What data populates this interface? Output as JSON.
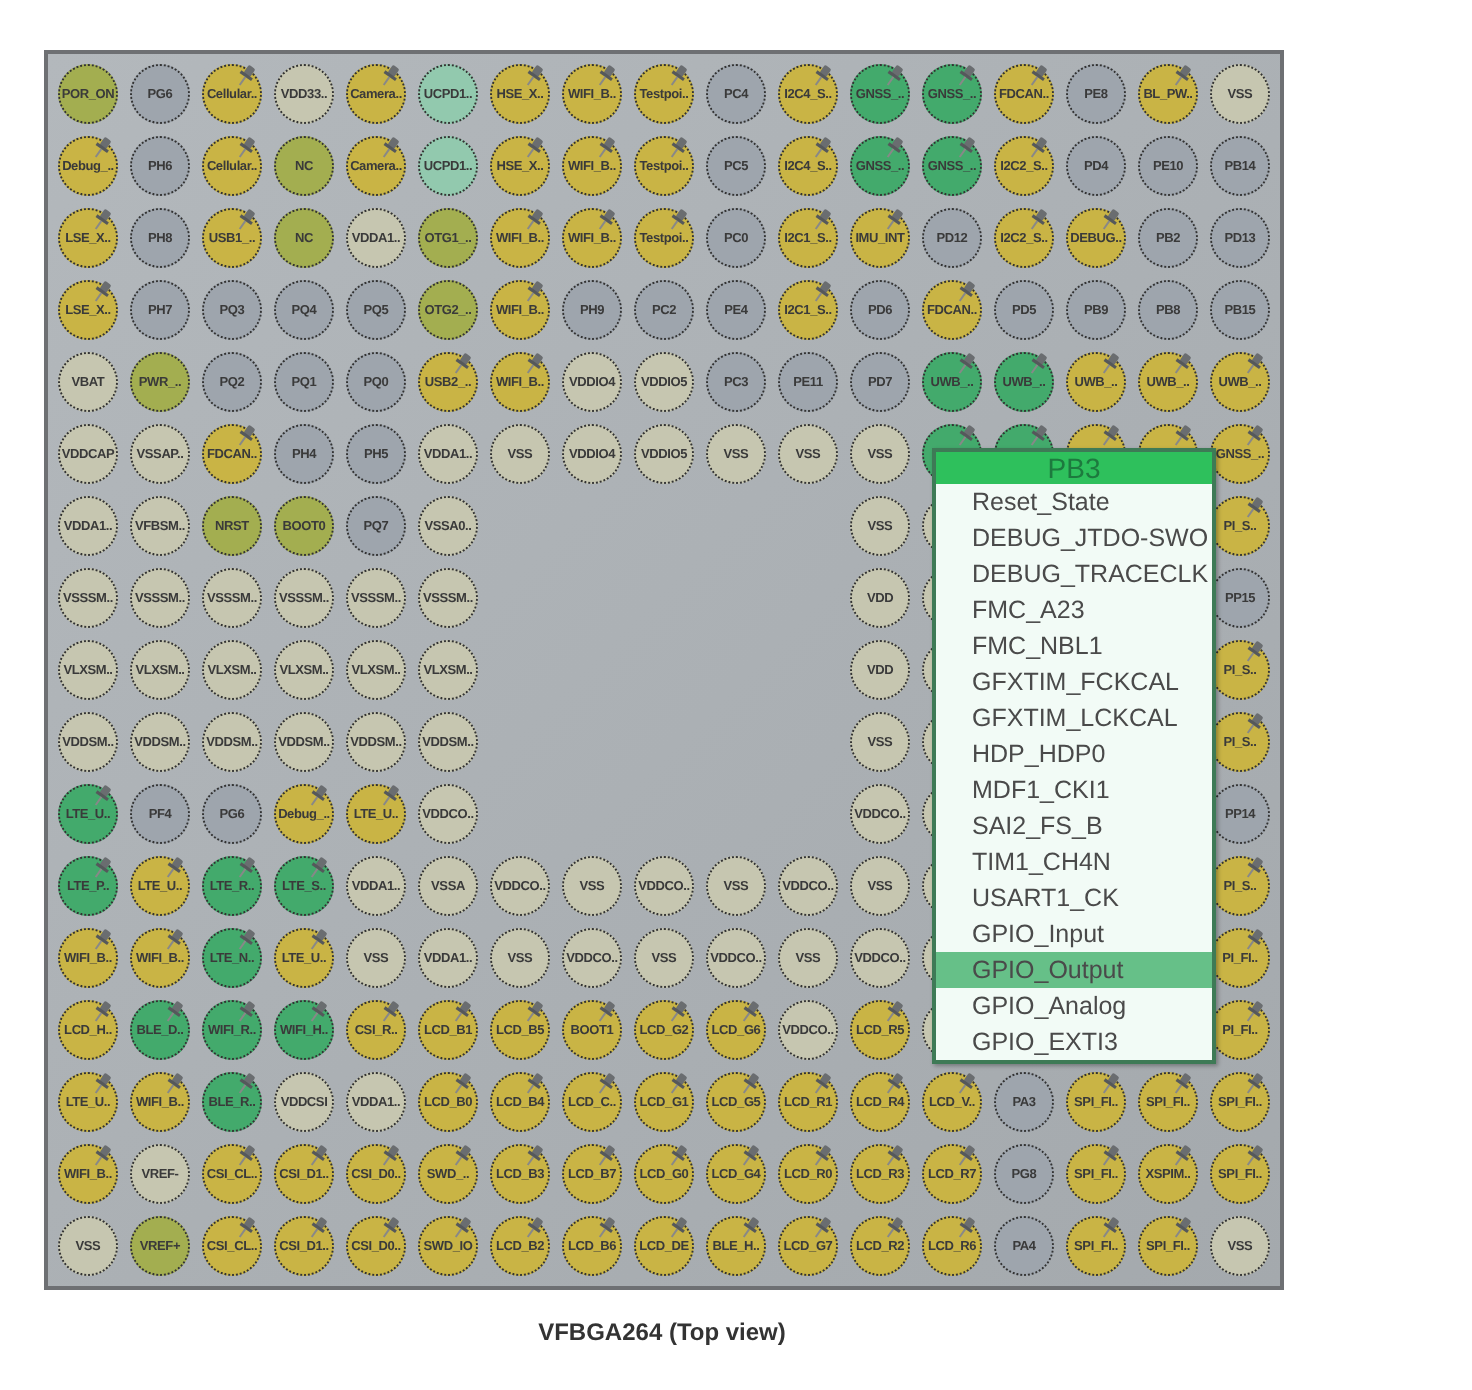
{
  "package": {
    "rows": [
      {
        "cells": [
          {
            "kind": "ball",
            "label": "POR_ON",
            "color": "#a3ae50",
            "pinned": false
          },
          {
            "kind": "ball",
            "label": "PG6",
            "color": "#9ea5ad",
            "pinned": false
          },
          {
            "kind": "ball",
            "label": "Cellular..",
            "color": "#c9b445",
            "pinned": true
          },
          {
            "kind": "ball",
            "label": "VDD33..",
            "color": "#c6c6b0",
            "pinned": false
          },
          {
            "kind": "ball",
            "label": "Camera..",
            "color": "#c9b445",
            "pinned": true
          },
          {
            "kind": "ball",
            "label": "UCPD1..",
            "color": "#92c9ae",
            "pinned": false
          },
          {
            "kind": "ball",
            "label": "HSE_X..",
            "color": "#c9b445",
            "pinned": true
          },
          {
            "kind": "ball",
            "label": "WIFI_B..",
            "color": "#c9b445",
            "pinned": true
          },
          {
            "kind": "ball",
            "label": "Testpoi..",
            "color": "#c9b445",
            "pinned": true
          },
          {
            "kind": "ball",
            "label": "PC4",
            "color": "#9ea5ad",
            "pinned": false
          },
          {
            "kind": "ball",
            "label": "I2C4_S..",
            "color": "#c9b445",
            "pinned": true
          },
          {
            "kind": "ball",
            "label": "GNSS_..",
            "color": "#43aa6c",
            "pinned": true
          },
          {
            "kind": "ball",
            "label": "GNSS_..",
            "color": "#43aa6c",
            "pinned": true
          },
          {
            "kind": "ball",
            "label": "FDCAN..",
            "color": "#c9b445",
            "pinned": true
          },
          {
            "kind": "ball",
            "label": "PE8",
            "color": "#9ea5ad",
            "pinned": false
          },
          {
            "kind": "ball",
            "label": "BL_PW..",
            "color": "#c9b445",
            "pinned": true
          },
          {
            "kind": "ball",
            "label": "VSS",
            "color": "#c6c6b0",
            "pinned": false
          }
        ]
      },
      {
        "cells": [
          {
            "kind": "ball",
            "label": "Debug_..",
            "color": "#c9b445",
            "pinned": true
          },
          {
            "kind": "ball",
            "label": "PH6",
            "color": "#9ea5ad",
            "pinned": false
          },
          {
            "kind": "ball",
            "label": "Cellular..",
            "color": "#c9b445",
            "pinned": true
          },
          {
            "kind": "ball",
            "label": "NC",
            "color": "#a3ae50",
            "pinned": false
          },
          {
            "kind": "ball",
            "label": "Camera..",
            "color": "#c9b445",
            "pinned": true
          },
          {
            "kind": "ball",
            "label": "UCPD1..",
            "color": "#92c9ae",
            "pinned": false
          },
          {
            "kind": "ball",
            "label": "HSE_X..",
            "color": "#c9b445",
            "pinned": true
          },
          {
            "kind": "ball",
            "label": "WIFI_B..",
            "color": "#c9b445",
            "pinned": true
          },
          {
            "kind": "ball",
            "label": "Testpoi..",
            "color": "#c9b445",
            "pinned": true
          },
          {
            "kind": "ball",
            "label": "PC5",
            "color": "#9ea5ad",
            "pinned": false
          },
          {
            "kind": "ball",
            "label": "I2C4_S..",
            "color": "#c9b445",
            "pinned": true
          },
          {
            "kind": "ball",
            "label": "GNSS_..",
            "color": "#43aa6c",
            "pinned": true
          },
          {
            "kind": "ball",
            "label": "GNSS_..",
            "color": "#43aa6c",
            "pinned": true
          },
          {
            "kind": "ball",
            "label": "I2C2_S..",
            "color": "#c9b445",
            "pinned": true
          },
          {
            "kind": "ball",
            "label": "PD4",
            "color": "#9ea5ad",
            "pinned": false
          },
          {
            "kind": "ball",
            "label": "PE10",
            "color": "#9ea5ad",
            "pinned": false
          },
          {
            "kind": "ball",
            "label": "PB14",
            "color": "#9ea5ad",
            "pinned": false
          }
        ]
      },
      {
        "cells": [
          {
            "kind": "ball",
            "label": "LSE_X..",
            "color": "#c9b445",
            "pinned": true
          },
          {
            "kind": "ball",
            "label": "PH8",
            "color": "#9ea5ad",
            "pinned": false
          },
          {
            "kind": "ball",
            "label": "USB1_..",
            "color": "#c9b445",
            "pinned": true
          },
          {
            "kind": "ball",
            "label": "NC",
            "color": "#a3ae50",
            "pinned": false
          },
          {
            "kind": "ball",
            "label": "VDDA1..",
            "color": "#c6c6b0",
            "pinned": false
          },
          {
            "kind": "ball",
            "label": "OTG1_..",
            "color": "#a3ae50",
            "pinned": false
          },
          {
            "kind": "ball",
            "label": "WIFI_B..",
            "color": "#c9b445",
            "pinned": true
          },
          {
            "kind": "ball",
            "label": "WIFI_B..",
            "color": "#c9b445",
            "pinned": true
          },
          {
            "kind": "ball",
            "label": "Testpoi..",
            "color": "#c9b445",
            "pinned": true
          },
          {
            "kind": "ball",
            "label": "PC0",
            "color": "#9ea5ad",
            "pinned": false
          },
          {
            "kind": "ball",
            "label": "I2C1_S..",
            "color": "#c9b445",
            "pinned": true
          },
          {
            "kind": "ball",
            "label": "IMU_INT",
            "color": "#c9b445",
            "pinned": true
          },
          {
            "kind": "ball",
            "label": "PD12",
            "color": "#9ea5ad",
            "pinned": false
          },
          {
            "kind": "ball",
            "label": "I2C2_S..",
            "color": "#c9b445",
            "pinned": true
          },
          {
            "kind": "ball",
            "label": "DEBUG..",
            "color": "#c9b445",
            "pinned": true
          },
          {
            "kind": "ball",
            "label": "PB2",
            "color": "#9ea5ad",
            "pinned": false
          },
          {
            "kind": "ball",
            "label": "PD13",
            "color": "#9ea5ad",
            "pinned": false
          }
        ]
      },
      {
        "cells": [
          {
            "kind": "ball",
            "label": "LSE_X..",
            "color": "#c9b445",
            "pinned": true
          },
          {
            "kind": "ball",
            "label": "PH7",
            "color": "#9ea5ad",
            "pinned": false
          },
          {
            "kind": "ball",
            "label": "PQ3",
            "color": "#9ea5ad",
            "pinned": false
          },
          {
            "kind": "ball",
            "label": "PQ4",
            "color": "#9ea5ad",
            "pinned": false
          },
          {
            "kind": "ball",
            "label": "PQ5",
            "color": "#9ea5ad",
            "pinned": false
          },
          {
            "kind": "ball",
            "label": "OTG2_..",
            "color": "#a3ae50",
            "pinned": false
          },
          {
            "kind": "ball",
            "label": "WIFI_B..",
            "color": "#c9b445",
            "pinned": true
          },
          {
            "kind": "ball",
            "label": "PH9",
            "color": "#9ea5ad",
            "pinned": false
          },
          {
            "kind": "ball",
            "label": "PC2",
            "color": "#9ea5ad",
            "pinned": false
          },
          {
            "kind": "ball",
            "label": "PE4",
            "color": "#9ea5ad",
            "pinned": false
          },
          {
            "kind": "ball",
            "label": "I2C1_S..",
            "color": "#c9b445",
            "pinned": true
          },
          {
            "kind": "ball",
            "label": "PD6",
            "color": "#9ea5ad",
            "pinned": false
          },
          {
            "kind": "ball",
            "label": "FDCAN..",
            "color": "#c9b445",
            "pinned": true
          },
          {
            "kind": "ball",
            "label": "PD5",
            "color": "#9ea5ad",
            "pinned": false
          },
          {
            "kind": "ball",
            "label": "PB9",
            "color": "#9ea5ad",
            "pinned": false
          },
          {
            "kind": "ball",
            "label": "PB8",
            "color": "#9ea5ad",
            "pinned": false
          },
          {
            "kind": "ball",
            "label": "PB15",
            "color": "#9ea5ad",
            "pinned": false
          }
        ]
      },
      {
        "cells": [
          {
            "kind": "ball",
            "label": "VBAT",
            "color": "#c6c6b0",
            "pinned": false
          },
          {
            "kind": "ball",
            "label": "PWR_..",
            "color": "#a3ae50",
            "pinned": false
          },
          {
            "kind": "ball",
            "label": "PQ2",
            "color": "#9ea5ad",
            "pinned": false
          },
          {
            "kind": "ball",
            "label": "PQ1",
            "color": "#9ea5ad",
            "pinned": false
          },
          {
            "kind": "ball",
            "label": "PQ0",
            "color": "#9ea5ad",
            "pinned": false
          },
          {
            "kind": "ball",
            "label": "USB2_..",
            "color": "#c9b445",
            "pinned": true
          },
          {
            "kind": "ball",
            "label": "WIFI_B..",
            "color": "#c9b445",
            "pinned": true
          },
          {
            "kind": "ball",
            "label": "VDDIO4",
            "color": "#c6c6b0",
            "pinned": false
          },
          {
            "kind": "ball",
            "label": "VDDIO5",
            "color": "#c6c6b0",
            "pinned": false
          },
          {
            "kind": "ball",
            "label": "PC3",
            "color": "#9ea5ad",
            "pinned": false
          },
          {
            "kind": "ball",
            "label": "PE11",
            "color": "#9ea5ad",
            "pinned": false
          },
          {
            "kind": "ball",
            "label": "PD7",
            "color": "#9ea5ad",
            "pinned": false
          },
          {
            "kind": "ball",
            "label": "UWB_..",
            "color": "#43aa6c",
            "pinned": true
          },
          {
            "kind": "ball",
            "label": "UWB_..",
            "color": "#43aa6c",
            "pinned": true
          },
          {
            "kind": "ball",
            "label": "UWB_..",
            "color": "#c9b445",
            "pinned": true
          },
          {
            "kind": "ball",
            "label": "UWB_..",
            "color": "#c9b445",
            "pinned": true
          },
          {
            "kind": "ball",
            "label": "UWB_..",
            "color": "#c9b445",
            "pinned": true
          }
        ]
      },
      {
        "cells": [
          {
            "kind": "ball",
            "label": "VDDCAP",
            "color": "#c6c6b0",
            "pinned": false
          },
          {
            "kind": "ball",
            "label": "VSSAP..",
            "color": "#c6c6b0",
            "pinned": false
          },
          {
            "kind": "ball",
            "label": "FDCAN..",
            "color": "#c9b445",
            "pinned": true
          },
          {
            "kind": "ball",
            "label": "PH4",
            "color": "#9ea5ad",
            "pinned": false
          },
          {
            "kind": "ball",
            "label": "PH5",
            "color": "#9ea5ad",
            "pinned": false
          },
          {
            "kind": "ball",
            "label": "VDDA1..",
            "color": "#c6c6b0",
            "pinned": false
          },
          {
            "kind": "ball",
            "label": "VSS",
            "color": "#c6c6b0",
            "pinned": false
          },
          {
            "kind": "ball",
            "label": "VDDIO4",
            "color": "#c6c6b0",
            "pinned": false
          },
          {
            "kind": "ball",
            "label": "VDDIO5",
            "color": "#c6c6b0",
            "pinned": false
          },
          {
            "kind": "ball",
            "label": "VSS",
            "color": "#c6c6b0",
            "pinned": false
          },
          {
            "kind": "ball",
            "label": "VSS",
            "color": "#c6c6b0",
            "pinned": false
          },
          {
            "kind": "ball",
            "label": "VSS",
            "color": "#c6c6b0",
            "pinned": false
          },
          {
            "kind": "ball",
            "color": "#43aa6c",
            "pinned": true
          },
          {
            "kind": "ball",
            "color": "#43aa6c",
            "pinned": true
          },
          {
            "kind": "ball",
            "color": "#c9b445",
            "pinned": true
          },
          {
            "kind": "ball",
            "color": "#c9b445",
            "pinned": true
          },
          {
            "kind": "ball",
            "label": "GNSS_..",
            "color": "#c9b445",
            "pinned": true
          }
        ]
      },
      {
        "cells": [
          {
            "kind": "ball",
            "label": "VDDA1..",
            "color": "#c6c6b0",
            "pinned": false
          },
          {
            "kind": "ball",
            "label": "VFBSM..",
            "color": "#c6c6b0",
            "pinned": false
          },
          {
            "kind": "ball",
            "label": "NRST",
            "color": "#a3ae50",
            "pinned": false
          },
          {
            "kind": "ball",
            "label": "BOOT0",
            "color": "#a3ae50",
            "pinned": false
          },
          {
            "kind": "ball",
            "label": "PQ7",
            "color": "#9ea5ad",
            "pinned": false
          },
          {
            "kind": "ball",
            "label": "VSSA0..",
            "color": "#c6c6b0",
            "pinned": false
          },
          {
            "kind": "gap"
          },
          {
            "kind": "gap"
          },
          {
            "kind": "gap"
          },
          {
            "kind": "gap"
          },
          {
            "kind": "gap"
          },
          {
            "kind": "ball",
            "label": "VSS",
            "color": "#c6c6b0",
            "pinned": false
          },
          {
            "kind": "ball",
            "color": "#c6c6b0"
          },
          {
            "kind": "gap"
          },
          {
            "kind": "gap"
          },
          {
            "kind": "gap"
          },
          {
            "kind": "ball",
            "label": "PI_S..",
            "color": "#c9b445",
            "pinned": true
          }
        ]
      },
      {
        "cells": [
          {
            "kind": "ball",
            "label": "VSSSM..",
            "color": "#c6c6b0",
            "pinned": false
          },
          {
            "kind": "ball",
            "label": "VSSSM..",
            "color": "#c6c6b0",
            "pinned": false
          },
          {
            "kind": "ball",
            "label": "VSSSM..",
            "color": "#c6c6b0",
            "pinned": false
          },
          {
            "kind": "ball",
            "label": "VSSSM..",
            "color": "#c6c6b0",
            "pinned": false
          },
          {
            "kind": "ball",
            "label": "VSSSM..",
            "color": "#c6c6b0",
            "pinned": false
          },
          {
            "kind": "ball",
            "label": "VSSSM..",
            "color": "#c6c6b0",
            "pinned": false
          },
          {
            "kind": "gap"
          },
          {
            "kind": "gap"
          },
          {
            "kind": "gap"
          },
          {
            "kind": "gap"
          },
          {
            "kind": "gap"
          },
          {
            "kind": "ball",
            "label": "VDD",
            "color": "#c6c6b0",
            "pinned": false
          },
          {
            "kind": "ball",
            "color": "#c6c6b0"
          },
          {
            "kind": "gap"
          },
          {
            "kind": "gap"
          },
          {
            "kind": "gap"
          },
          {
            "kind": "ball",
            "label": "PP15",
            "color": "#9ea5ad",
            "pinned": false
          }
        ]
      },
      {
        "cells": [
          {
            "kind": "ball",
            "label": "VLXSM..",
            "color": "#c6c6b0",
            "pinned": false
          },
          {
            "kind": "ball",
            "label": "VLXSM..",
            "color": "#c6c6b0",
            "pinned": false
          },
          {
            "kind": "ball",
            "label": "VLXSM..",
            "color": "#c6c6b0",
            "pinned": false
          },
          {
            "kind": "ball",
            "label": "VLXSM..",
            "color": "#c6c6b0",
            "pinned": false
          },
          {
            "kind": "ball",
            "label": "VLXSM..",
            "color": "#c6c6b0",
            "pinned": false
          },
          {
            "kind": "ball",
            "label": "VLXSM..",
            "color": "#c6c6b0",
            "pinned": false
          },
          {
            "kind": "gap"
          },
          {
            "kind": "gap"
          },
          {
            "kind": "gap"
          },
          {
            "kind": "gap"
          },
          {
            "kind": "gap"
          },
          {
            "kind": "ball",
            "label": "VDD",
            "color": "#c6c6b0",
            "pinned": false
          },
          {
            "kind": "ball",
            "color": "#c6c6b0"
          },
          {
            "kind": "gap"
          },
          {
            "kind": "gap"
          },
          {
            "kind": "gap"
          },
          {
            "kind": "ball",
            "label": "PI_S..",
            "color": "#c9b445",
            "pinned": true
          }
        ]
      },
      {
        "cells": [
          {
            "kind": "ball",
            "label": "VDDSM..",
            "color": "#c6c6b0",
            "pinned": false
          },
          {
            "kind": "ball",
            "label": "VDDSM..",
            "color": "#c6c6b0",
            "pinned": false
          },
          {
            "kind": "ball",
            "label": "VDDSM..",
            "color": "#c6c6b0",
            "pinned": false
          },
          {
            "kind": "ball",
            "label": "VDDSM..",
            "color": "#c6c6b0",
            "pinned": false
          },
          {
            "kind": "ball",
            "label": "VDDSM..",
            "color": "#c6c6b0",
            "pinned": false
          },
          {
            "kind": "ball",
            "label": "VDDSM..",
            "color": "#c6c6b0",
            "pinned": false
          },
          {
            "kind": "gap"
          },
          {
            "kind": "gap"
          },
          {
            "kind": "gap"
          },
          {
            "kind": "gap"
          },
          {
            "kind": "gap"
          },
          {
            "kind": "ball",
            "label": "VSS",
            "color": "#c6c6b0",
            "pinned": false
          },
          {
            "kind": "ball",
            "color": "#c6c6b0"
          },
          {
            "kind": "gap"
          },
          {
            "kind": "gap"
          },
          {
            "kind": "gap"
          },
          {
            "kind": "ball",
            "label": "PI_S..",
            "color": "#c9b445",
            "pinned": true
          }
        ]
      },
      {
        "cells": [
          {
            "kind": "ball",
            "label": "LTE_U..",
            "color": "#43aa6c",
            "pinned": true
          },
          {
            "kind": "ball",
            "label": "PF4",
            "color": "#9ea5ad",
            "pinned": false
          },
          {
            "kind": "ball",
            "label": "PG6",
            "color": "#9ea5ad",
            "pinned": false
          },
          {
            "kind": "ball",
            "label": "Debug_..",
            "color": "#c9b445",
            "pinned": true
          },
          {
            "kind": "ball",
            "label": "LTE_U..",
            "color": "#c9b445",
            "pinned": true
          },
          {
            "kind": "ball",
            "label": "VDDCO..",
            "color": "#c6c6b0",
            "pinned": false
          },
          {
            "kind": "gap"
          },
          {
            "kind": "gap"
          },
          {
            "kind": "gap"
          },
          {
            "kind": "gap"
          },
          {
            "kind": "gap"
          },
          {
            "kind": "ball",
            "label": "VDDCO..",
            "color": "#c6c6b0",
            "pinned": false
          },
          {
            "kind": "ball",
            "color": "#c6c6b0"
          },
          {
            "kind": "gap"
          },
          {
            "kind": "gap"
          },
          {
            "kind": "gap"
          },
          {
            "kind": "ball",
            "label": "PP14",
            "color": "#9ea5ad",
            "pinned": false
          }
        ]
      },
      {
        "cells": [
          {
            "kind": "ball",
            "label": "LTE_P..",
            "color": "#43aa6c",
            "pinned": true
          },
          {
            "kind": "ball",
            "label": "LTE_U..",
            "color": "#c9b445",
            "pinned": true
          },
          {
            "kind": "ball",
            "label": "LTE_R..",
            "color": "#43aa6c",
            "pinned": true
          },
          {
            "kind": "ball",
            "label": "LTE_S..",
            "color": "#43aa6c",
            "pinned": true
          },
          {
            "kind": "ball",
            "label": "VDDA1..",
            "color": "#c6c6b0",
            "pinned": false
          },
          {
            "kind": "ball",
            "label": "VSSA",
            "color": "#c6c6b0",
            "pinned": false
          },
          {
            "kind": "ball",
            "label": "VDDCO..",
            "color": "#c6c6b0",
            "pinned": false
          },
          {
            "kind": "ball",
            "label": "VSS",
            "color": "#c6c6b0",
            "pinned": false
          },
          {
            "kind": "ball",
            "label": "VDDCO..",
            "color": "#c6c6b0",
            "pinned": false
          },
          {
            "kind": "ball",
            "label": "VSS",
            "color": "#c6c6b0",
            "pinned": false
          },
          {
            "kind": "ball",
            "label": "VDDCO..",
            "color": "#c6c6b0",
            "pinned": false
          },
          {
            "kind": "ball",
            "label": "VSS",
            "color": "#c6c6b0",
            "pinned": false
          },
          {
            "kind": "ball",
            "color": "#c6c6b0"
          },
          {
            "kind": "gap"
          },
          {
            "kind": "gap"
          },
          {
            "kind": "gap"
          },
          {
            "kind": "ball",
            "label": "PI_S..",
            "color": "#c9b445",
            "pinned": true
          }
        ]
      },
      {
        "cells": [
          {
            "kind": "ball",
            "label": "WIFI_B..",
            "color": "#c9b445",
            "pinned": true
          },
          {
            "kind": "ball",
            "label": "WIFI_B..",
            "color": "#c9b445",
            "pinned": true
          },
          {
            "kind": "ball",
            "label": "LTE_N..",
            "color": "#43aa6c",
            "pinned": true
          },
          {
            "kind": "ball",
            "label": "LTE_U..",
            "color": "#c9b445",
            "pinned": true
          },
          {
            "kind": "ball",
            "label": "VSS",
            "color": "#c6c6b0",
            "pinned": false
          },
          {
            "kind": "ball",
            "label": "VDDA1..",
            "color": "#c6c6b0",
            "pinned": false
          },
          {
            "kind": "ball",
            "label": "VSS",
            "color": "#c6c6b0",
            "pinned": false
          },
          {
            "kind": "ball",
            "label": "VDDCO..",
            "color": "#c6c6b0",
            "pinned": false
          },
          {
            "kind": "ball",
            "label": "VSS",
            "color": "#c6c6b0",
            "pinned": false
          },
          {
            "kind": "ball",
            "label": "VDDCO..",
            "color": "#c6c6b0",
            "pinned": false
          },
          {
            "kind": "ball",
            "label": "VSS",
            "color": "#c6c6b0",
            "pinned": false
          },
          {
            "kind": "ball",
            "label": "VDDCO..",
            "color": "#c6c6b0",
            "pinned": false
          },
          {
            "kind": "ball",
            "color": "#c6c6b0"
          },
          {
            "kind": "gap"
          },
          {
            "kind": "gap"
          },
          {
            "kind": "gap"
          },
          {
            "kind": "ball",
            "label": "PI_FI..",
            "color": "#c9b445",
            "pinned": true
          }
        ]
      },
      {
        "cells": [
          {
            "kind": "ball",
            "label": "LCD_H..",
            "color": "#c9b445",
            "pinned": true
          },
          {
            "kind": "ball",
            "label": "BLE_D..",
            "color": "#43aa6c",
            "pinned": true
          },
          {
            "kind": "ball",
            "label": "WIFI_R..",
            "color": "#43aa6c",
            "pinned": true
          },
          {
            "kind": "ball",
            "label": "WIFI_H..",
            "color": "#43aa6c",
            "pinned": true
          },
          {
            "kind": "ball",
            "label": "CSI_R..",
            "color": "#c9b445",
            "pinned": true
          },
          {
            "kind": "ball",
            "label": "LCD_B1",
            "color": "#c9b445",
            "pinned": true
          },
          {
            "kind": "ball",
            "label": "LCD_B5",
            "color": "#c9b445",
            "pinned": true
          },
          {
            "kind": "ball",
            "label": "BOOT1",
            "color": "#c9b445",
            "pinned": true
          },
          {
            "kind": "ball",
            "label": "LCD_G2",
            "color": "#c9b445",
            "pinned": true
          },
          {
            "kind": "ball",
            "label": "LCD_G6",
            "color": "#c9b445",
            "pinned": true
          },
          {
            "kind": "ball",
            "label": "VDDCO..",
            "color": "#c6c6b0",
            "pinned": false
          },
          {
            "kind": "ball",
            "label": "LCD_R5",
            "color": "#c9b445",
            "pinned": true
          },
          {
            "kind": "ball",
            "color": "#c6c6b0"
          },
          {
            "kind": "gap"
          },
          {
            "kind": "gap"
          },
          {
            "kind": "gap"
          },
          {
            "kind": "ball",
            "label": "PI_FI..",
            "color": "#c9b445",
            "pinned": true
          }
        ]
      },
      {
        "cells": [
          {
            "kind": "ball",
            "label": "LTE_U..",
            "color": "#c9b445",
            "pinned": true
          },
          {
            "kind": "ball",
            "label": "WIFI_B..",
            "color": "#c9b445",
            "pinned": true
          },
          {
            "kind": "ball",
            "label": "BLE_R..",
            "color": "#43aa6c",
            "pinned": true
          },
          {
            "kind": "ball",
            "label": "VDDCSI",
            "color": "#c6c6b0",
            "pinned": false
          },
          {
            "kind": "ball",
            "label": "VDDA1..",
            "color": "#c6c6b0",
            "pinned": false
          },
          {
            "kind": "ball",
            "label": "LCD_B0",
            "color": "#c9b445",
            "pinned": true
          },
          {
            "kind": "ball",
            "label": "LCD_B4",
            "color": "#c9b445",
            "pinned": true
          },
          {
            "kind": "ball",
            "label": "LCD_C..",
            "color": "#c9b445",
            "pinned": true
          },
          {
            "kind": "ball",
            "label": "LCD_G1",
            "color": "#c9b445",
            "pinned": true
          },
          {
            "kind": "ball",
            "label": "LCD_G5",
            "color": "#c9b445",
            "pinned": true
          },
          {
            "kind": "ball",
            "label": "LCD_R1",
            "color": "#c9b445",
            "pinned": true
          },
          {
            "kind": "ball",
            "label": "LCD_R4",
            "color": "#c9b445",
            "pinned": true
          },
          {
            "kind": "ball",
            "label": "LCD_V..",
            "color": "#c9b445",
            "pinned": true
          },
          {
            "kind": "ball",
            "label": "PA3",
            "color": "#9ea5ad",
            "pinned": false
          },
          {
            "kind": "ball",
            "label": "SPI_FI..",
            "color": "#c9b445",
            "pinned": true
          },
          {
            "kind": "ball",
            "label": "SPI_FI..",
            "color": "#c9b445",
            "pinned": true
          },
          {
            "kind": "ball",
            "label": "SPI_FI..",
            "color": "#c9b445",
            "pinned": true
          }
        ]
      },
      {
        "cells": [
          {
            "kind": "ball",
            "label": "WIFI_B..",
            "color": "#c9b445",
            "pinned": true
          },
          {
            "kind": "ball",
            "label": "VREF-",
            "color": "#c6c6b0",
            "pinned": false
          },
          {
            "kind": "ball",
            "label": "CSI_CL..",
            "color": "#c9b445",
            "pinned": true
          },
          {
            "kind": "ball",
            "label": "CSI_D1..",
            "color": "#c9b445",
            "pinned": true
          },
          {
            "kind": "ball",
            "label": "CSI_D0..",
            "color": "#c9b445",
            "pinned": true
          },
          {
            "kind": "ball",
            "label": "SWD_..",
            "color": "#c9b445",
            "pinned": true
          },
          {
            "kind": "ball",
            "label": "LCD_B3",
            "color": "#c9b445",
            "pinned": true
          },
          {
            "kind": "ball",
            "label": "LCD_B7",
            "color": "#c9b445",
            "pinned": true
          },
          {
            "kind": "ball",
            "label": "LCD_G0",
            "color": "#c9b445",
            "pinned": true
          },
          {
            "kind": "ball",
            "label": "LCD_G4",
            "color": "#c9b445",
            "pinned": true
          },
          {
            "kind": "ball",
            "label": "LCD_R0",
            "color": "#c9b445",
            "pinned": true
          },
          {
            "kind": "ball",
            "label": "LCD_R3",
            "color": "#c9b445",
            "pinned": true
          },
          {
            "kind": "ball",
            "label": "LCD_R7",
            "color": "#c9b445",
            "pinned": true
          },
          {
            "kind": "ball",
            "label": "PG8",
            "color": "#9ea5ad",
            "pinned": false
          },
          {
            "kind": "ball",
            "label": "SPI_FI..",
            "color": "#c9b445",
            "pinned": true
          },
          {
            "kind": "ball",
            "label": "XSPIM..",
            "color": "#c9b445",
            "pinned": true
          },
          {
            "kind": "ball",
            "label": "SPI_FI..",
            "color": "#c9b445",
            "pinned": true
          }
        ]
      },
      {
        "cells": [
          {
            "kind": "ball",
            "label": "VSS",
            "color": "#c6c6b0",
            "pinned": false
          },
          {
            "kind": "ball",
            "label": "VREF+",
            "color": "#a3ae50",
            "pinned": false
          },
          {
            "kind": "ball",
            "label": "CSI_CL..",
            "color": "#c9b445",
            "pinned": true
          },
          {
            "kind": "ball",
            "label": "CSI_D1..",
            "color": "#c9b445",
            "pinned": true
          },
          {
            "kind": "ball",
            "label": "CSI_D0..",
            "color": "#c9b445",
            "pinned": true
          },
          {
            "kind": "ball",
            "label": "SWD_IO",
            "color": "#c9b445",
            "pinned": true
          },
          {
            "kind": "ball",
            "label": "LCD_B2",
            "color": "#c9b445",
            "pinned": true
          },
          {
            "kind": "ball",
            "label": "LCD_B6",
            "color": "#c9b445",
            "pinned": true
          },
          {
            "kind": "ball",
            "label": "LCD_DE",
            "color": "#c9b445",
            "pinned": true
          },
          {
            "kind": "ball",
            "label": "BLE_H..",
            "color": "#c9b445",
            "pinned": true
          },
          {
            "kind": "ball",
            "label": "LCD_G7",
            "color": "#c9b445",
            "pinned": true
          },
          {
            "kind": "ball",
            "label": "LCD_R2",
            "color": "#c9b445",
            "pinned": true
          },
          {
            "kind": "ball",
            "label": "LCD_R6",
            "color": "#c9b445",
            "pinned": true
          },
          {
            "kind": "ball",
            "label": "PA4",
            "color": "#9ea5ad",
            "pinned": false
          },
          {
            "kind": "ball",
            "label": "SPI_FI..",
            "color": "#c9b445",
            "pinned": true
          },
          {
            "kind": "ball",
            "label": "SPI_FI..",
            "color": "#c9b445",
            "pinned": true
          },
          {
            "kind": "ball",
            "label": "VSS",
            "color": "#c6c6b0",
            "pinned": false
          }
        ]
      }
    ],
    "menu": {
      "title": "PB3",
      "items": [
        {
          "label": "Reset_State",
          "selected": false
        },
        {
          "label": "DEBUG_JTDO-SWO",
          "selected": false
        },
        {
          "label": "DEBUG_TRACECLK",
          "selected": false
        },
        {
          "label": "FMC_A23",
          "selected": false
        },
        {
          "label": "FMC_NBL1",
          "selected": false
        },
        {
          "label": "GFXTIM_FCKCAL",
          "selected": false
        },
        {
          "label": "GFXTIM_LCKCAL",
          "selected": false
        },
        {
          "label": "HDP_HDP0",
          "selected": false
        },
        {
          "label": "MDF1_CKI1",
          "selected": false
        },
        {
          "label": "SAI2_FS_B",
          "selected": false
        },
        {
          "label": "TIM1_CH4N",
          "selected": false
        },
        {
          "label": "USART1_CK",
          "selected": false
        },
        {
          "label": "GPIO_Input",
          "selected": false
        },
        {
          "label": "GPIO_Output",
          "selected": true
        },
        {
          "label": "GPIO_Analog",
          "selected": false
        },
        {
          "label": "GPIO_EXTI3",
          "selected": false
        }
      ]
    }
  },
  "caption": "VFBGA264 (Top view)"
}
